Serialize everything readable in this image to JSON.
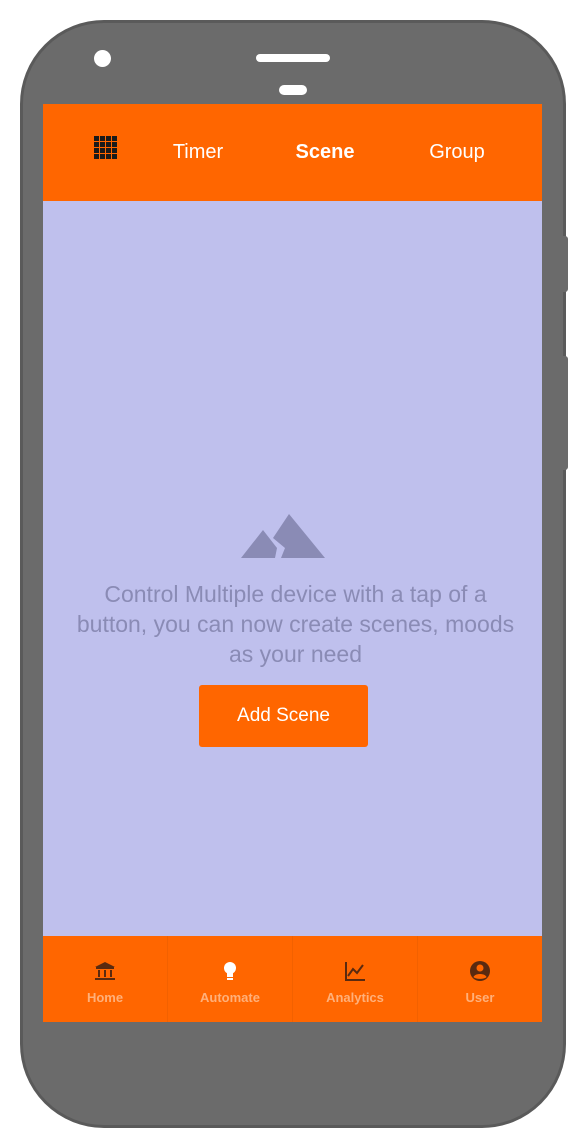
{
  "topbar": {
    "menu_icon": "grid-icon",
    "tabs": [
      {
        "label": "Timer",
        "active": false
      },
      {
        "label": "Scene",
        "active": true
      },
      {
        "label": "Group",
        "active": false
      }
    ]
  },
  "empty_state": {
    "icon": "mountain-icon",
    "message": "Control Multiple device with a tap of a button, you can now create scenes, moods as your need",
    "button_label": "Add Scene"
  },
  "bottom_nav": {
    "items": [
      {
        "label": "Home",
        "icon": "bank-icon"
      },
      {
        "label": "Automate",
        "icon": "lightbulb-icon"
      },
      {
        "label": "Analytics",
        "icon": "line-chart-icon"
      },
      {
        "label": "User",
        "icon": "account-circle-icon"
      }
    ]
  },
  "colors": {
    "accent": "#ff6600",
    "screen_bg": "#bfc0ed",
    "phone_body": "#6b6b6b",
    "muted_text": "#8a8bb5",
    "nav_label": "#ffb07a",
    "nav_icon": "#5a2a10"
  }
}
